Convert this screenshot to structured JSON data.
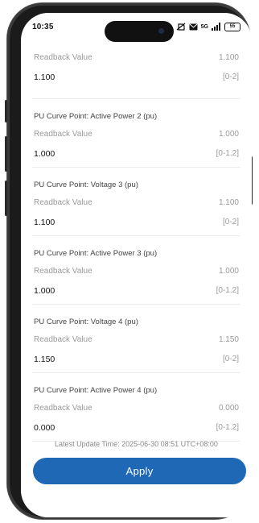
{
  "status_bar": {
    "time": "10:35",
    "network": "5G",
    "battery": "55"
  },
  "params": [
    {
      "title": "",
      "label": "Readback Value",
      "readback": "1.100",
      "value": "1.100",
      "range": "[0-2]"
    },
    {
      "title": "PU Curve Point: Active Power 2 (pu)",
      "label": "Readback Value",
      "readback": "1.000",
      "value": "1.000",
      "range": "[0-1.2]"
    },
    {
      "title": "PU Curve Point: Voltage 3 (pu)",
      "label": "Readback Value",
      "readback": "1.100",
      "value": "1.100",
      "range": "[0-2]"
    },
    {
      "title": "PU Curve Point: Active Power 3 (pu)",
      "label": "Readback Value",
      "readback": "1.000",
      "value": "1.000",
      "range": "[0-1.2]"
    },
    {
      "title": "PU Curve Point: Voltage 4 (pu)",
      "label": "Readback Value",
      "readback": "1.150",
      "value": "1.150",
      "range": "[0-2]"
    },
    {
      "title": "PU Curve Point: Active Power 4 (pu)",
      "label": "Readback Value",
      "readback": "0.000",
      "value": "0.000",
      "range": "[0-1.2]"
    }
  ],
  "footer": {
    "update_time": "Latest Update Time: 2025-06-30 08:51 UTC+08:00",
    "apply_label": "Apply"
  },
  "colors": {
    "accent": "#1f68b5"
  }
}
